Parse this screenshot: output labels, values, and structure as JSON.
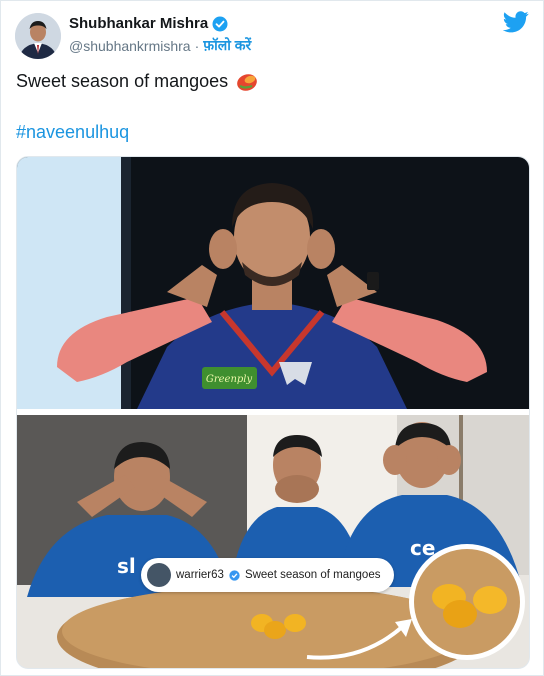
{
  "user": {
    "display_name": "Shubhankar Mishra",
    "handle": "@shubhankrmishra",
    "separator": "·",
    "follow_label": "फ़ॉलो करें",
    "verified_icon": "verified-badge-icon"
  },
  "tweet": {
    "text": "Sweet season of mangoes",
    "emoji_icon": "mango-icon",
    "hashtag": "#naveenulhuq"
  },
  "media": {
    "overlay_caption": {
      "username": "warrier63",
      "text": "Sweet season of mangoes"
    },
    "jersey_text_left": "sl",
    "jersey_text_right": "ce"
  },
  "colors": {
    "link": "#1b95e0",
    "twitter_blue": "#1da1f2",
    "text_primary": "#14171a",
    "text_secondary": "#657786",
    "lsg_jersey": "#233a8a",
    "mi_jersey": "#1c5fb0",
    "mango": "#f2b423"
  }
}
